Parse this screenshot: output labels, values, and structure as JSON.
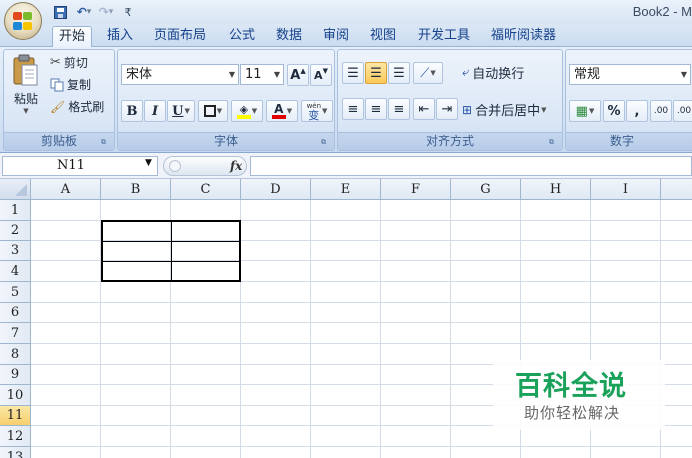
{
  "title_bar": {
    "title": "Book2 - M"
  },
  "quick_access": {
    "undo_glyph": "↶",
    "redo_glyph": "↷",
    "dropdown_glyph": "▾",
    "customize_glyph": "₹"
  },
  "tabs": [
    "开始",
    "插入",
    "页面布局",
    "公式",
    "数据",
    "审阅",
    "视图",
    "开发工具",
    "福昕阅读器"
  ],
  "active_tab": "开始",
  "ribbon": {
    "clipboard": {
      "label": "剪贴板",
      "paste": "粘贴",
      "cut": "剪切",
      "copy": "复制",
      "format_painter": "格式刷"
    },
    "font": {
      "label": "字体",
      "font_name": "宋体",
      "font_size": "11",
      "grow": "A",
      "shrink": "A",
      "bold": "B",
      "italic": "I",
      "underline": "U",
      "font_color_letter": "A",
      "phonetic": "wén",
      "phonetic_char": "变"
    },
    "alignment": {
      "label": "对齐方式",
      "wrap_text": "自动换行",
      "merge_center": "合并后居中"
    },
    "number": {
      "label": "数字",
      "format": "常规",
      "percent": "%",
      "comma": ",",
      "increase_decimal": ".00",
      "decrease_decimal": ".00"
    }
  },
  "formula_bar": {
    "name_box": "N11",
    "fx_label": "fx",
    "formula": ""
  },
  "grid": {
    "columns": [
      "A",
      "B",
      "C",
      "D",
      "E",
      "F",
      "G",
      "H",
      "I"
    ],
    "rows": [
      "1",
      "2",
      "3",
      "4",
      "5",
      "6",
      "7",
      "8",
      "9",
      "10",
      "11",
      "12",
      "13"
    ],
    "active_row": "11"
  },
  "watermark": {
    "title": "百科全说",
    "subtitle": "助你轻松解决"
  },
  "colors": {
    "accent": "#15428b",
    "active_row": "#f7cf6c",
    "watermark_green": "#1aa15a"
  }
}
